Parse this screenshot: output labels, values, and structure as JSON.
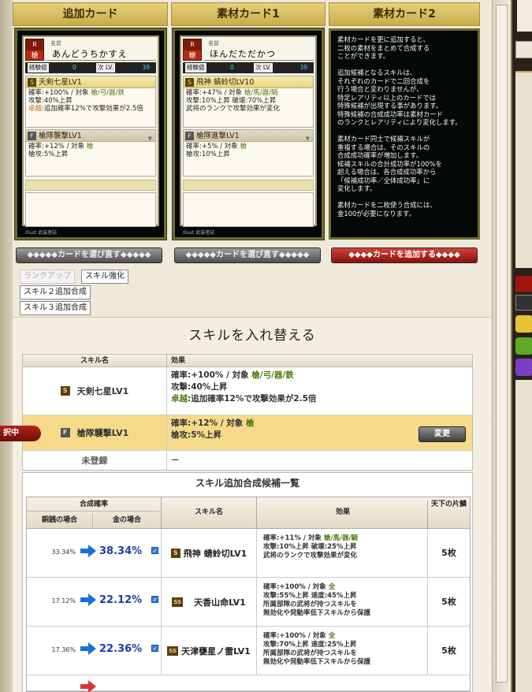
{
  "columns": {
    "add_card": "追加カード",
    "material1": "素材カード1",
    "material2": "素材カード2"
  },
  "card_common": {
    "emblem_text": "槍",
    "emblem_rank": "R",
    "name_label": "名前",
    "exp_label": "経験値",
    "level_label": "次 LV.",
    "credit": "Illust 武装者誌"
  },
  "add_card": {
    "name": "あんどうちかすえ",
    "exp": "0",
    "level": "39",
    "skill1": {
      "grade": "S",
      "title": "天剣七星LV1",
      "line1_pre": "確率:+100% / 対象 ",
      "line1_targets": "槍/弓/器/鉄",
      "line2": "攻撃:40%上昇",
      "line3_tag": "卓越",
      "line3": ":追加確率12%で攻撃効果が2.5倍"
    },
    "skill2": {
      "grade": "F",
      "title": "槍隊襲撃LV1",
      "line1_pre": "確率:+12% / 対象 ",
      "line1_targets": "槍",
      "line2": "槍攻:5%上昇"
    }
  },
  "material1": {
    "name": "ほんだただかつ",
    "exp": "0",
    "level": "39",
    "skill1": {
      "grade": "S",
      "title": "飛神 蜻蛉切LV10",
      "line1_pre": "確率:+47% / 対象 ",
      "line1_targets": "槍/馬/器/騎",
      "line2": "攻撃:10%上昇 破壊:70%上昇",
      "line3": "武将のランクで攻撃効果が変化"
    },
    "skill2": {
      "grade": "F",
      "title": "槍隊進撃LV1",
      "line1_pre": "確率:+5% / 対象 ",
      "line1_targets": "槍",
      "line2": "槍攻:10%上昇"
    }
  },
  "material2_description": "素材カードを更に追加すると、\n二枚の素材をまとめて合成する\nことができます。\n\n追加候補となるスキルは、\nそれぞれのカードで二回合成を\n行う場合と変わりませんが、\n特定レアリティ以上のカードでは\n特殊候補が出現する事があります。\n特殊候補の合成成功率は素材カード\nのランクとレアリティにより変化します。\n\n素材カード同士で候補スキルが\n重複する場合は、そのスキルの\n合成成功確率が増加します。\n候補スキルの合計成功率が100%を\n超える場合は、各合成成功率から\n「候補成功率／全体成功率」に\n変化します。\n\n素材カードを二枚使う合成には、\n金100が必要になります。",
  "buttons": {
    "reselect1": "◆◆◆◆◆カードを選び直す◆◆◆◆◆",
    "reselect2": "◆◆◆◆◆カードを選び直す◆◆◆◆◆",
    "add_card": "◆◆◆◆カードを追加する◆◆◆◆",
    "rank_up": "ランクアップ",
    "skill_enhance": "スキル強化",
    "skill2_add": "スキル２追加合成",
    "skill3_add": "スキル３追加合成",
    "change": "変更"
  },
  "swap": {
    "title": "スキルを入れ替える",
    "col_name": "スキル名",
    "col_effect": "効果",
    "selecting_tag": "択中",
    "rows": [
      {
        "grade": "S",
        "name": "天剣七星LV1",
        "l1_pre": "確率:+100% / 対象 ",
        "l1_targets": "槍/弓/器/鉄",
        "l2": "攻撃:40%上昇",
        "l3_tag": "卓越",
        "l3": ":追加確率12%で攻撃効果が2.5倍"
      },
      {
        "grade": "F",
        "name": "槍隊襲撃LV1",
        "l1_pre": "確率:+12% / 対象 ",
        "l1_targets": "槍",
        "l2": "槍攻:5%上昇"
      },
      {
        "name": "未登録",
        "l1": "－"
      }
    ]
  },
  "candidates": {
    "title": "スキル追加合成候補一覧",
    "col_rate": "合成確率",
    "col_copper": "銅銭の場合",
    "col_gold": "金の場合",
    "col_name": "スキル名",
    "col_effect": "効果",
    "col_count": "天下の片鱗",
    "rows": [
      {
        "copper": "33.34%",
        "gold": "38.34%",
        "grade": "S",
        "name": "飛神 蜻蛉切LV1",
        "e1_pre": "確率:+11% / 対象 ",
        "e1_targets": "槍/馬/器/騎",
        "e2": "攻撃:10%上昇 破壊:25%上昇",
        "e3": "武将のランクで攻撃効果が変化",
        "e4": "",
        "count": "5枚"
      },
      {
        "copper": "17.12%",
        "gold": "22.12%",
        "grade": "SS",
        "name": "天香山命LV1",
        "e1_pre": "確率:+100% / 対象 ",
        "e1_targets": "全",
        "e2": "攻撃:55%上昇 速度:45%上昇",
        "e3": "所属部隊の武将が持つスキルを",
        "e4": "無効化や発動率低下スキルから保護",
        "count": "5枚"
      },
      {
        "copper": "17.36%",
        "gold": "22.36%",
        "grade": "SS",
        "name": "天津甕星ノ雷LV1",
        "e1_pre": "確率:+100% / 対象 ",
        "e1_targets": "全",
        "e2": "攻撃:70%上昇 速度:25%上昇",
        "e3": "所属部隊の武将が持つスキルを",
        "e4": "無効化や発動率低下スキルから保護",
        "count": "5枚"
      }
    ]
  },
  "colors": {
    "arrow_blue": "#1a6fe0",
    "gold_header": "#d8bf5e",
    "selected_row": "#f7d98a"
  }
}
